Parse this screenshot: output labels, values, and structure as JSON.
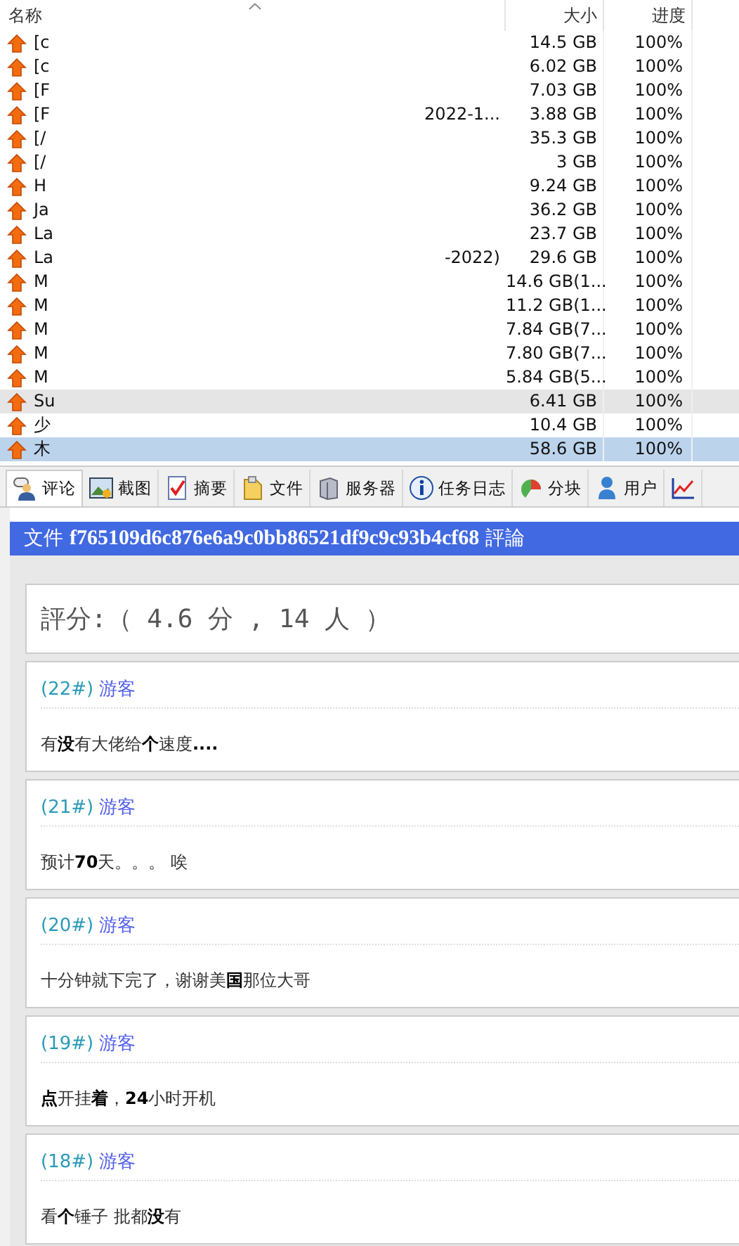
{
  "file_list": {
    "columns": [
      {
        "label": "名称"
      },
      {
        "label": "大小"
      },
      {
        "label": "进度"
      }
    ],
    "rows": [
      {
        "name_start": "[c",
        "size": "14.5 GB",
        "progress": "100%",
        "selected": false,
        "highlighted": false
      },
      {
        "name_start": "[c",
        "size": "6.02 GB",
        "progress": "100%",
        "selected": false,
        "highlighted": false
      },
      {
        "name_start": "[F",
        "size": "7.03 GB",
        "progress": "100%",
        "selected": false,
        "highlighted": false
      },
      {
        "name_start": "[F",
        "name_end": "2022-1...",
        "size": "3.88 GB",
        "progress": "100%",
        "selected": false,
        "highlighted": false
      },
      {
        "name_start": "[/",
        "size": "35.3 GB",
        "progress": "100%",
        "selected": false,
        "highlighted": false
      },
      {
        "name_start": "[/",
        "size": "3 GB",
        "progress": "100%",
        "selected": false,
        "highlighted": false
      },
      {
        "name_start": "H",
        "size": "9.24 GB",
        "progress": "100%",
        "selected": false,
        "highlighted": false
      },
      {
        "name_start": "Ja",
        "size": "36.2 GB",
        "progress": "100%",
        "selected": false,
        "highlighted": false
      },
      {
        "name_start": "La",
        "size": "23.7 GB",
        "progress": "100%",
        "selected": false,
        "highlighted": false
      },
      {
        "name_start": "La",
        "name_end": "-2022)",
        "size": "29.6 GB",
        "progress": "100%",
        "selected": false,
        "highlighted": false
      },
      {
        "name_start": "M",
        "size": "14.6 GB(1...",
        "progress": "100%",
        "selected": false,
        "highlighted": false
      },
      {
        "name_start": "M",
        "size": "11.2 GB(1...",
        "progress": "100%",
        "selected": false,
        "highlighted": false
      },
      {
        "name_start": "M",
        "size": "7.84 GB(7...",
        "progress": "100%",
        "selected": false,
        "highlighted": false
      },
      {
        "name_start": "M",
        "size": "7.80 GB(7...",
        "progress": "100%",
        "selected": false,
        "highlighted": false
      },
      {
        "name_start": "M",
        "size": "5.84 GB(5...",
        "progress": "100%",
        "selected": false,
        "highlighted": false
      },
      {
        "name_start": "Su",
        "size": "6.41 GB",
        "progress": "100%",
        "selected": false,
        "highlighted": true
      },
      {
        "name_start": "少",
        "size": "10.4 GB",
        "progress": "100%",
        "selected": false,
        "highlighted": false
      },
      {
        "name_start": "木",
        "size": "58.6 GB",
        "progress": "100%",
        "selected": true,
        "highlighted": false
      }
    ]
  },
  "tabs": [
    {
      "label": "评论",
      "kind": "comment",
      "selected": true
    },
    {
      "label": "截图",
      "kind": "picture",
      "selected": false
    },
    {
      "label": "摘要",
      "kind": "checklist",
      "selected": false
    },
    {
      "label": "文件",
      "kind": "file",
      "selected": false
    },
    {
      "label": "服务器",
      "kind": "server",
      "selected": false
    },
    {
      "label": "任务日志",
      "kind": "info",
      "selected": false
    },
    {
      "label": "分块",
      "kind": "pie",
      "selected": false
    },
    {
      "label": "用户",
      "kind": "user",
      "selected": false
    },
    {
      "kind": "chart",
      "selected": false
    }
  ],
  "comments_panel": {
    "title_prefix": "文件",
    "file_hash": "f765109d6c876e6a9c0bb86521df9c9c93b4cf68",
    "title_suffix": "評論",
    "rating": "評分:（ 4.6 分 , 14 人 ）",
    "comments": [
      {
        "number": "(22#)",
        "author": "游客",
        "text": "有**没**有大佬给**个**速度**....**"
      },
      {
        "number": "(21#)",
        "author": "游客",
        "text": "预计**70**天。。。 唉"
      },
      {
        "number": "(20#)",
        "author": "游客",
        "text": "十分钟就下完了，谢谢美**国**那位大哥"
      },
      {
        "number": "(19#)",
        "author": "游客",
        "text": "**点**开挂**着**，**24**小时开机"
      },
      {
        "number": "(18#)",
        "author": "游客",
        "text": "看**个**锤子 批都**没**有"
      }
    ]
  }
}
